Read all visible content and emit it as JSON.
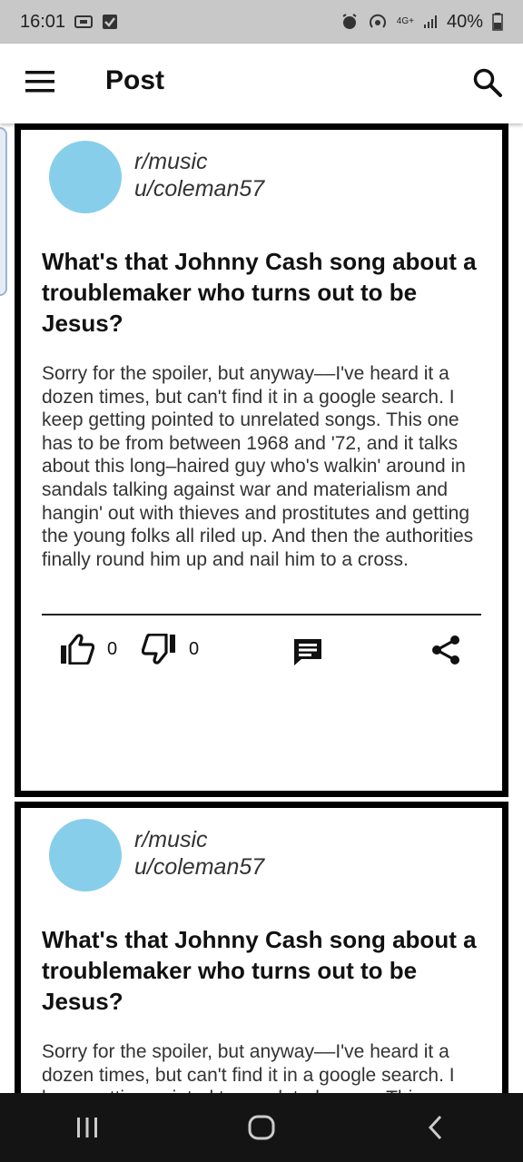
{
  "status_bar": {
    "time": "16:01",
    "battery": "40%",
    "network": "4G+"
  },
  "app_bar": {
    "title": "Post"
  },
  "posts": [
    {
      "subreddit": "r/music",
      "user": "u/coleman57",
      "title": "What's that Johnny Cash song about a troublemaker who turns out to be Jesus?",
      "body": "Sorry for the spoiler, but anyway––I've heard it a dozen times, but can't find it in a google search. I keep getting pointed to unrelated songs. This one has to be from between 1968 and '72, and it talks about this long–haired guy who's walkin' around in sandals talking against war and materialism and hangin' out with thieves and prostitutes and getting the young folks all riled up. And then the authorities finally round him up and nail him to a cross.",
      "likes": "0",
      "dislikes": "0"
    },
    {
      "subreddit": "r/music",
      "user": "u/coleman57",
      "title": "What's that Johnny Cash song about a troublemaker who turns out to be Jesus?",
      "body": "Sorry for the spoiler, but anyway––I've heard it a dozen times, but can't find it in a google search. I keep getting pointed to unrelated songs. This one"
    }
  ],
  "icons": {
    "menu": "hamburger-menu-icon",
    "search": "search-icon",
    "like": "thumbs-up-icon",
    "dislike": "thumbs-down-icon",
    "comment": "comment-icon",
    "share": "share-icon"
  },
  "colors": {
    "avatar": "#87ceeb",
    "status_bar": "#c8c8c8",
    "nav_bar": "#141414"
  }
}
